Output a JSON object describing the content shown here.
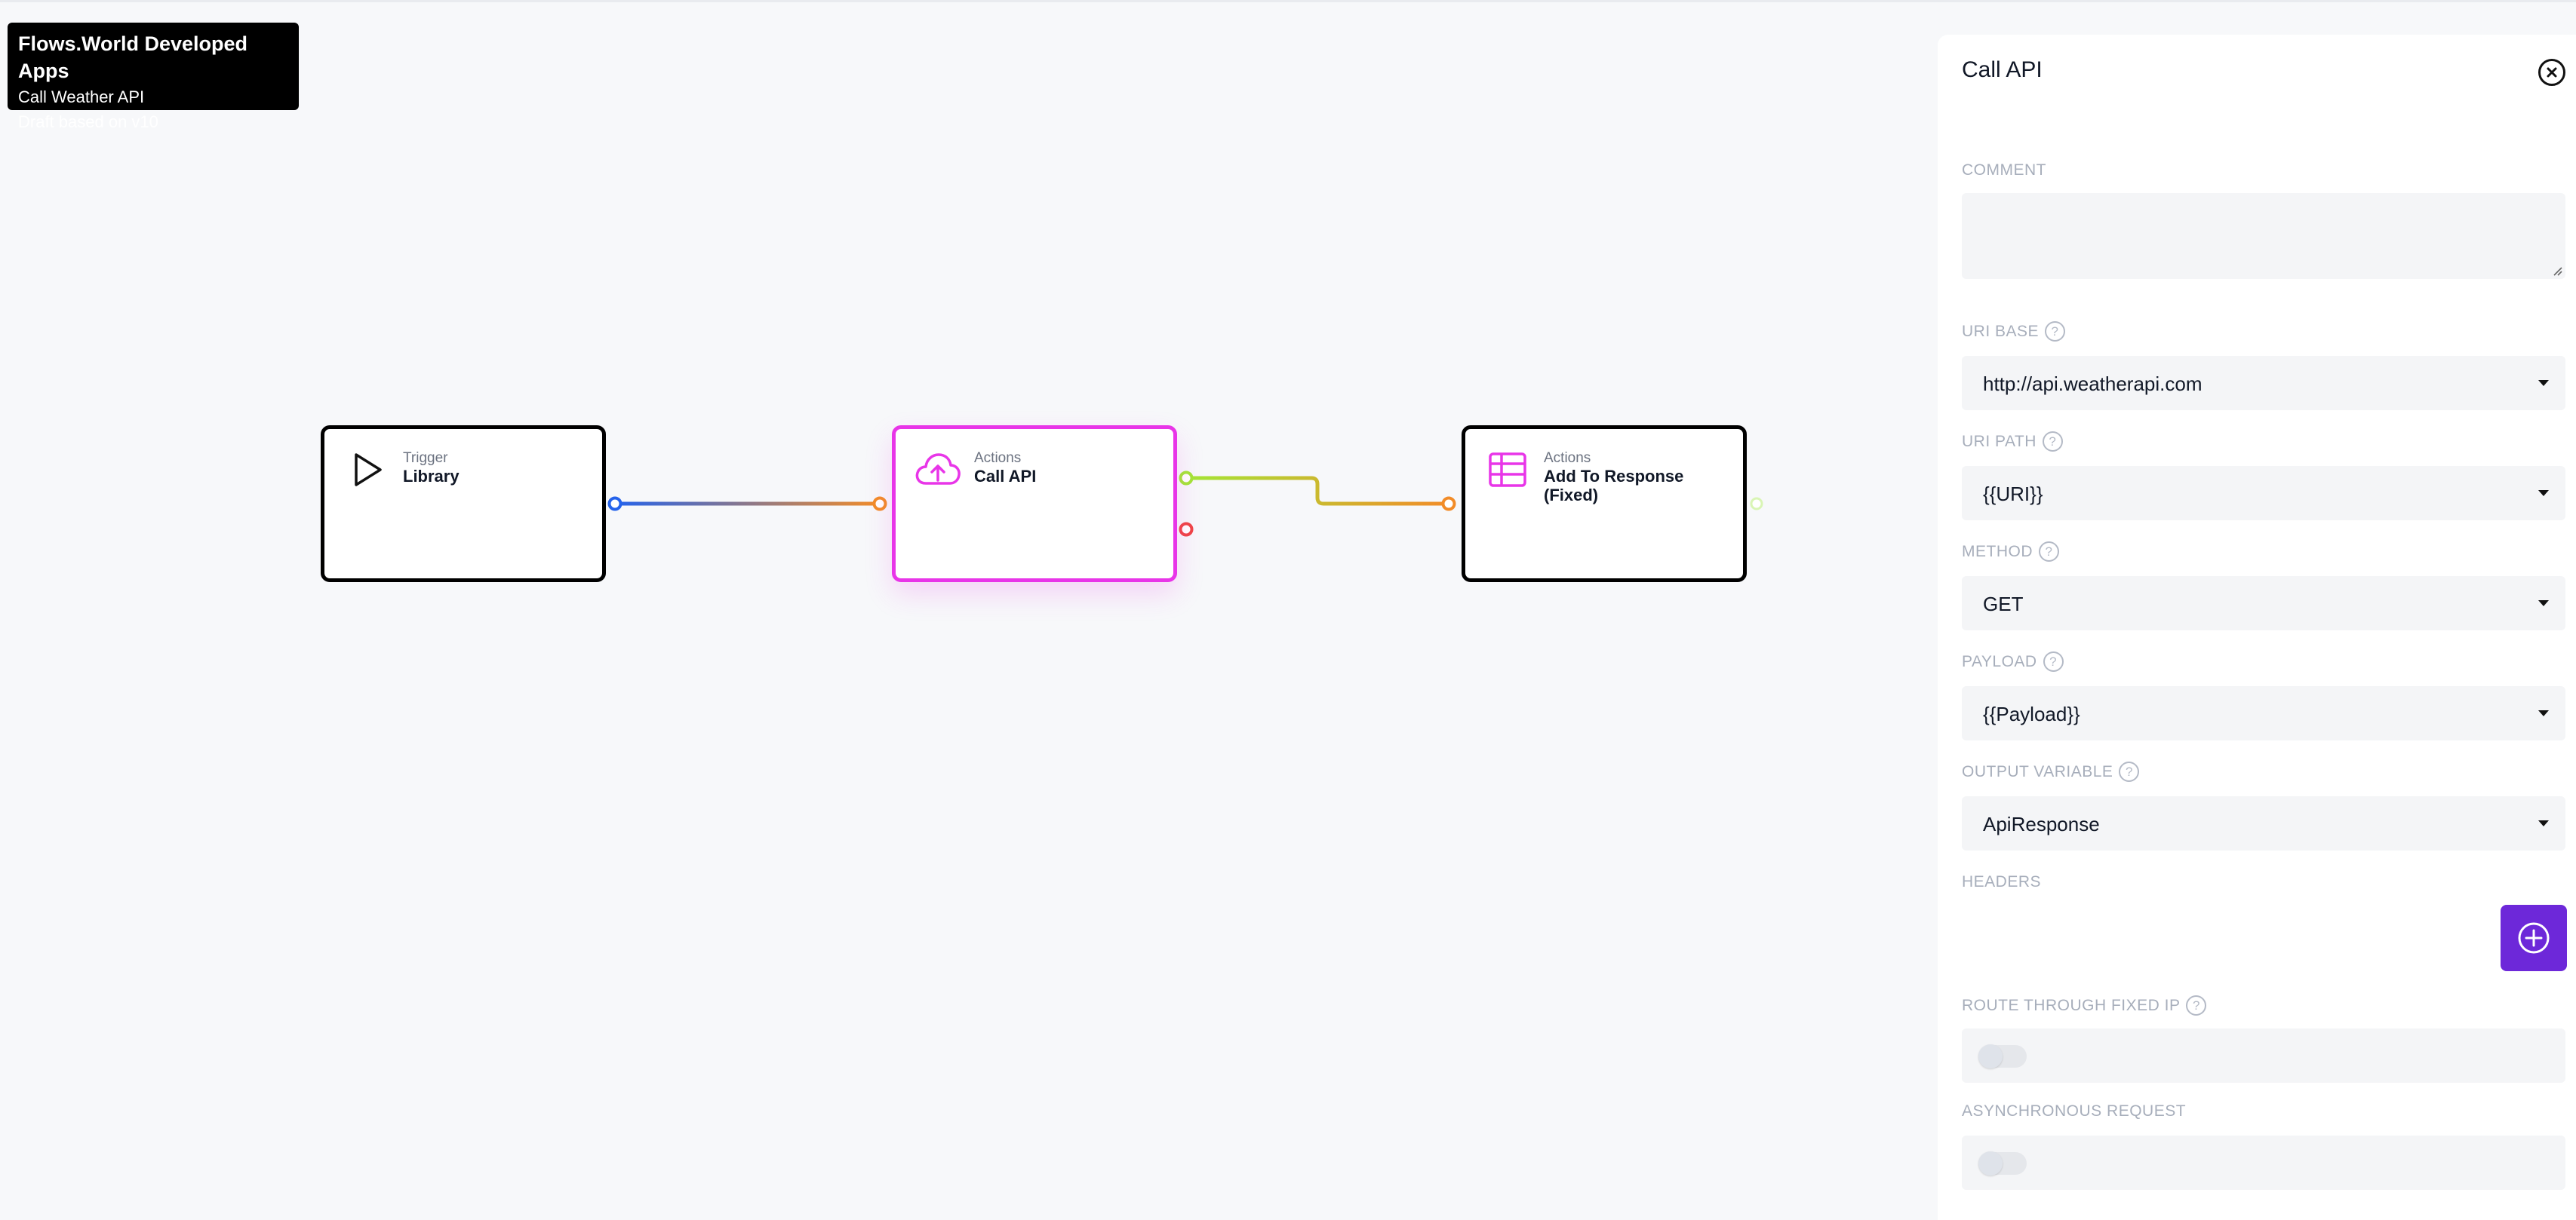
{
  "info": {
    "app_name": "Flows.World Developed Apps",
    "flow_name": "Call Weather API",
    "draft": "Draft based on v10"
  },
  "nodes": [
    {
      "kind": "Trigger",
      "name": "Library",
      "icon": "play-icon"
    },
    {
      "kind": "Actions",
      "name": "Call API",
      "icon": "cloud-upload-icon",
      "selected": true
    },
    {
      "kind": "Actions",
      "name": "Add To Response (Fixed)",
      "icon": "table-icon"
    }
  ],
  "panel": {
    "title": "Call API",
    "comment_label": "Comment",
    "comment_value": "",
    "uri_base_label": "URI Base",
    "uri_base_value": "http://api.weatherapi.com",
    "uri_path_label": "URI Path",
    "uri_path_value": "{{URI}}",
    "method_label": "Method",
    "method_value": "GET",
    "payload_label": "Payload",
    "payload_value": "{{Payload}}",
    "output_label": "Output Variable",
    "output_value": "ApiResponse",
    "headers_label": "Headers",
    "fixed_ip_label": "Route Through Fixed IP",
    "fixed_ip_on": false,
    "async_label": "Asynchronous Request",
    "async_on": false,
    "help_glyph": "?"
  },
  "colors": {
    "accent": "#6d28d9",
    "selected_node": "#e835e8",
    "edge_blue": "#2563eb",
    "edge_orange": "#f28c28",
    "edge_green": "#a3e635",
    "error_port": "#ef4444"
  }
}
